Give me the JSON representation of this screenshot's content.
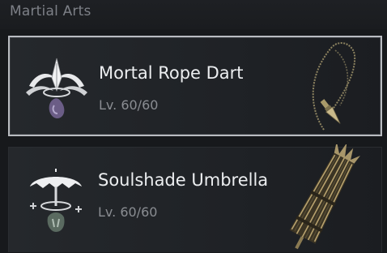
{
  "section": {
    "title": "Martial Arts"
  },
  "items": [
    {
      "name": "Mortal Rope Dart",
      "level": "Lv. 60/60",
      "icon": "rope-dart-skill-icon",
      "weapon_art": "rope-dart-weapon-art",
      "selected": true
    },
    {
      "name": "Soulshade Umbrella",
      "level": "Lv. 60/60",
      "icon": "umbrella-skill-icon",
      "weapon_art": "umbrella-weapon-art",
      "selected": false
    }
  ],
  "colors": {
    "background": "#17191c",
    "card": "#222529",
    "selected_border": "#b9bcc1",
    "title_text": "#eceef0",
    "level_text": "#8a8d92",
    "header_text": "#7d8087",
    "gem_purple": "#6b5d86",
    "gem_green": "#5a6a60",
    "gold": "#a89a6a"
  }
}
